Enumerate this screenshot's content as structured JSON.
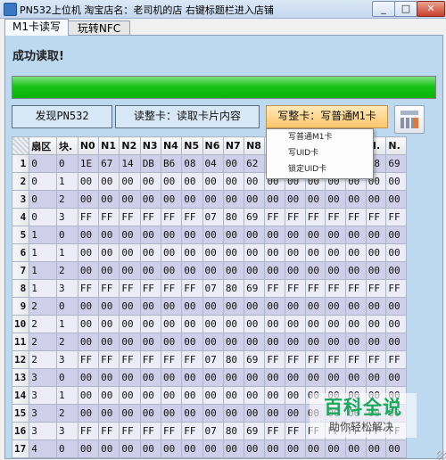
{
  "window": {
    "title": "PN532上位机 淘宝店名：老司机的店 右键标题栏进入店铺"
  },
  "tabs": [
    {
      "label": "M1卡读写"
    },
    {
      "label": "玩转NFC"
    }
  ],
  "status": {
    "text": "成功读取!"
  },
  "progress": {
    "value_percent": 100,
    "color": "#19c419"
  },
  "buttons": {
    "discover": "发现PN532",
    "read_all": "读整卡：读取卡片内容",
    "write_all": "写整卡：写普通M1卡"
  },
  "dropdown": {
    "items": [
      "写普通M1卡",
      "写UID卡",
      "锁定UID卡"
    ]
  },
  "grid": {
    "headers": [
      "扇区",
      "块.",
      "N0",
      "N1",
      "N2",
      "N3",
      "N4",
      "N5",
      "N6",
      "N7",
      "N8",
      "N9",
      "N10",
      "N11",
      "N12",
      "N13",
      "N14",
      "N15"
    ],
    "header_display": [
      "扇区",
      "块.",
      "N0",
      "N1",
      "N2",
      "N3",
      "N4",
      "N5",
      "N6",
      "N7",
      "N8",
      "N.",
      "N.",
      "N.",
      "N.",
      "N.",
      "N.",
      "N."
    ],
    "rows": [
      {
        "n": "1",
        "sector": "0",
        "block": "0",
        "cells": [
          "1E",
          "67",
          "14",
          "DB",
          "B6",
          "08",
          "04",
          "00",
          "62",
          "",
          "",
          "",
          "",
          "67",
          "68",
          "69"
        ]
      },
      {
        "n": "2",
        "sector": "0",
        "block": "1",
        "cells": [
          "00",
          "00",
          "00",
          "00",
          "00",
          "00",
          "00",
          "00",
          "00",
          "00",
          "00",
          "00",
          "00",
          "00",
          "00",
          "00"
        ]
      },
      {
        "n": "3",
        "sector": "0",
        "block": "2",
        "cells": [
          "00",
          "00",
          "00",
          "00",
          "00",
          "00",
          "00",
          "00",
          "00",
          "00",
          "00",
          "00",
          "00",
          "00",
          "00",
          "00"
        ]
      },
      {
        "n": "4",
        "sector": "0",
        "block": "3",
        "cells": [
          "FF",
          "FF",
          "FF",
          "FF",
          "FF",
          "FF",
          "07",
          "80",
          "69",
          "FF",
          "FF",
          "FF",
          "FF",
          "FF",
          "FF",
          "FF"
        ]
      },
      {
        "n": "5",
        "sector": "1",
        "block": "0",
        "cells": [
          "00",
          "00",
          "00",
          "00",
          "00",
          "00",
          "00",
          "00",
          "00",
          "00",
          "00",
          "00",
          "00",
          "00",
          "00",
          "00"
        ]
      },
      {
        "n": "6",
        "sector": "1",
        "block": "1",
        "cells": [
          "00",
          "00",
          "00",
          "00",
          "00",
          "00",
          "00",
          "00",
          "00",
          "00",
          "00",
          "00",
          "00",
          "00",
          "00",
          "00"
        ]
      },
      {
        "n": "7",
        "sector": "1",
        "block": "2",
        "cells": [
          "00",
          "00",
          "00",
          "00",
          "00",
          "00",
          "00",
          "00",
          "00",
          "00",
          "00",
          "00",
          "00",
          "00",
          "00",
          "00"
        ]
      },
      {
        "n": "8",
        "sector": "1",
        "block": "3",
        "cells": [
          "FF",
          "FF",
          "FF",
          "FF",
          "FF",
          "FF",
          "07",
          "80",
          "69",
          "FF",
          "FF",
          "FF",
          "FF",
          "FF",
          "FF",
          "FF"
        ]
      },
      {
        "n": "9",
        "sector": "2",
        "block": "0",
        "cells": [
          "00",
          "00",
          "00",
          "00",
          "00",
          "00",
          "00",
          "00",
          "00",
          "00",
          "00",
          "00",
          "00",
          "00",
          "00",
          "00"
        ]
      },
      {
        "n": "10",
        "sector": "2",
        "block": "1",
        "cells": [
          "00",
          "00",
          "00",
          "00",
          "00",
          "00",
          "00",
          "00",
          "00",
          "00",
          "00",
          "00",
          "00",
          "00",
          "00",
          "00"
        ]
      },
      {
        "n": "11",
        "sector": "2",
        "block": "2",
        "cells": [
          "00",
          "00",
          "00",
          "00",
          "00",
          "00",
          "00",
          "00",
          "00",
          "00",
          "00",
          "00",
          "00",
          "00",
          "00",
          "00"
        ]
      },
      {
        "n": "12",
        "sector": "2",
        "block": "3",
        "cells": [
          "FF",
          "FF",
          "FF",
          "FF",
          "FF",
          "FF",
          "07",
          "80",
          "69",
          "FF",
          "FF",
          "FF",
          "FF",
          "FF",
          "FF",
          "FF"
        ]
      },
      {
        "n": "13",
        "sector": "3",
        "block": "0",
        "cells": [
          "00",
          "00",
          "00",
          "00",
          "00",
          "00",
          "00",
          "00",
          "00",
          "00",
          "00",
          "00",
          "00",
          "00",
          "00",
          "00"
        ]
      },
      {
        "n": "14",
        "sector": "3",
        "block": "1",
        "cells": [
          "00",
          "00",
          "00",
          "00",
          "00",
          "00",
          "00",
          "00",
          "00",
          "00",
          "00",
          "00",
          "00",
          "00",
          "00",
          "00"
        ]
      },
      {
        "n": "15",
        "sector": "3",
        "block": "2",
        "cells": [
          "00",
          "00",
          "00",
          "00",
          "00",
          "00",
          "00",
          "00",
          "00",
          "00",
          "00",
          "00",
          "00",
          "00",
          "00",
          "00"
        ]
      },
      {
        "n": "16",
        "sector": "3",
        "block": "3",
        "cells": [
          "FF",
          "FF",
          "FF",
          "FF",
          "FF",
          "FF",
          "07",
          "80",
          "69",
          "FF",
          "FF",
          "FF",
          "FF",
          "FF",
          "FF",
          "FF"
        ]
      },
      {
        "n": "17",
        "sector": "4",
        "block": "0",
        "cells": [
          "00",
          "00",
          "00",
          "00",
          "00",
          "00",
          "00",
          "00",
          "00",
          "00",
          "00",
          "00",
          "00",
          "00",
          "00",
          "00"
        ]
      },
      {
        "n": "18",
        "sector": "4",
        "block": "1",
        "cells": [
          "00",
          "00",
          "00",
          "00",
          "00",
          "00",
          "00",
          "00",
          "00",
          "00",
          "00",
          "00",
          "00",
          "00",
          "00",
          "00"
        ]
      }
    ]
  },
  "watermark": {
    "title": "百科全说",
    "subtitle": "助你轻松解决"
  }
}
